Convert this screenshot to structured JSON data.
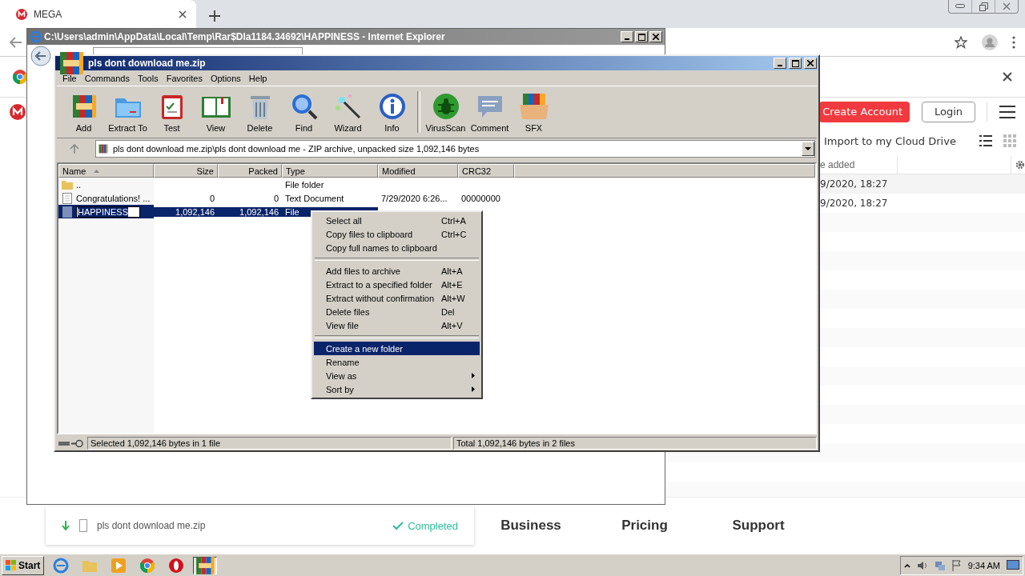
{
  "browser": {
    "tab": {
      "title": "MEGA",
      "selected": true
    }
  },
  "mega": {
    "buttons": [
      {
        "label": "Create Account",
        "kind": "primary"
      },
      {
        "label": "Login",
        "kind": "outline"
      }
    ],
    "import_label": "Import to my Cloud Drive",
    "column": "e added",
    "rows": [
      "9/2020, 18:27",
      "9/2020, 18:27"
    ],
    "download": {
      "file": "pls dont download me.zip",
      "status": "Completed"
    },
    "nav": [
      "Business",
      "Pricing",
      "Support"
    ]
  },
  "ie_window": {
    "title": "C:\\Users\\admin\\AppData\\Local\\Temp\\Rar$DIa1184.34692\\HAPPINESS - Internet Explorer"
  },
  "winrar": {
    "title": "pls dont download me.zip",
    "menu": [
      "File",
      "Commands",
      "Tools",
      "Favorites",
      "Options",
      "Help"
    ],
    "toolbar": [
      {
        "label": "Add",
        "kind": "books"
      },
      {
        "label": "Extract To",
        "kind": "folder"
      },
      {
        "label": "Test",
        "kind": "clipboard"
      },
      {
        "label": "View",
        "kind": "book"
      },
      {
        "label": "Delete",
        "kind": "trash"
      },
      {
        "label": "Find",
        "kind": "magnifier"
      },
      {
        "label": "Wizard",
        "kind": "wand"
      },
      {
        "label": "Info",
        "kind": "info"
      },
      {
        "label": "VirusScan",
        "kind": "bug"
      },
      {
        "label": "Comment",
        "kind": "bubble"
      },
      {
        "label": "SFX",
        "kind": "box"
      }
    ],
    "address": "pls dont download me.zip\\pls dont download me - ZIP archive, unpacked size 1,092,146 bytes",
    "columns": [
      {
        "label": "Name",
        "sorted": true
      },
      {
        "label": "Size",
        "sorted": false
      },
      {
        "label": "Packed",
        "sorted": false
      },
      {
        "label": "Type",
        "sorted": false
      },
      {
        "label": "Modified",
        "sorted": false
      },
      {
        "label": "CRC32",
        "sorted": false
      }
    ],
    "rows": [
      {
        "kind": "folder",
        "name": "..",
        "type": "File folder",
        "selected": false,
        "renaming": false
      },
      {
        "kind": "text",
        "name": "Congratulations! ...",
        "size": "0",
        "packed": "0",
        "type": "Text Document",
        "modified": "7/29/2020 6:26...",
        "crc": "00000000",
        "selected": false,
        "renaming": false
      },
      {
        "kind": "file",
        "name": "HAPPINESS",
        "size": "1,092,146",
        "packed": "1,092,146",
        "type": "File",
        "selected": true,
        "renaming": true
      }
    ],
    "status": [
      "Selected 1,092,146 bytes in 1 file",
      "Total 1,092,146 bytes in 2 files"
    ]
  },
  "context_menu": [
    [
      {
        "label": "Select all",
        "shortcut": "Ctrl+A",
        "submenu": false,
        "selected": false
      },
      {
        "label": "Copy files to clipboard",
        "shortcut": "Ctrl+C",
        "submenu": false,
        "selected": false
      },
      {
        "label": "Copy full names to clipboard",
        "submenu": false,
        "selected": false
      }
    ],
    [
      {
        "label": "Add files to archive",
        "shortcut": "Alt+A",
        "submenu": false,
        "selected": false
      },
      {
        "label": "Extract to a specified folder",
        "shortcut": "Alt+E",
        "submenu": false,
        "selected": false
      },
      {
        "label": "Extract without confirmation",
        "shortcut": "Alt+W",
        "submenu": false,
        "selected": false
      },
      {
        "label": "Delete files",
        "shortcut": "Del",
        "submenu": false,
        "selected": false
      },
      {
        "label": "View file",
        "shortcut": "Alt+V",
        "submenu": false,
        "selected": false
      }
    ],
    [
      {
        "label": "Create a new folder",
        "submenu": false,
        "selected": true
      },
      {
        "label": "Rename",
        "submenu": false,
        "selected": false
      },
      {
        "label": "View as",
        "submenu": true,
        "selected": false
      },
      {
        "label": "Sort by",
        "submenu": true,
        "selected": false
      }
    ]
  ],
  "taskbar": {
    "start": "Start",
    "apps": [
      {
        "kind": "ie",
        "selected": false
      },
      {
        "kind": "explorer",
        "selected": false
      },
      {
        "kind": "media",
        "selected": false
      },
      {
        "kind": "chrome",
        "selected": false
      },
      {
        "kind": "opera",
        "selected": false
      },
      {
        "kind": "winrar",
        "selected": true
      }
    ],
    "time": "9:34 AM"
  }
}
